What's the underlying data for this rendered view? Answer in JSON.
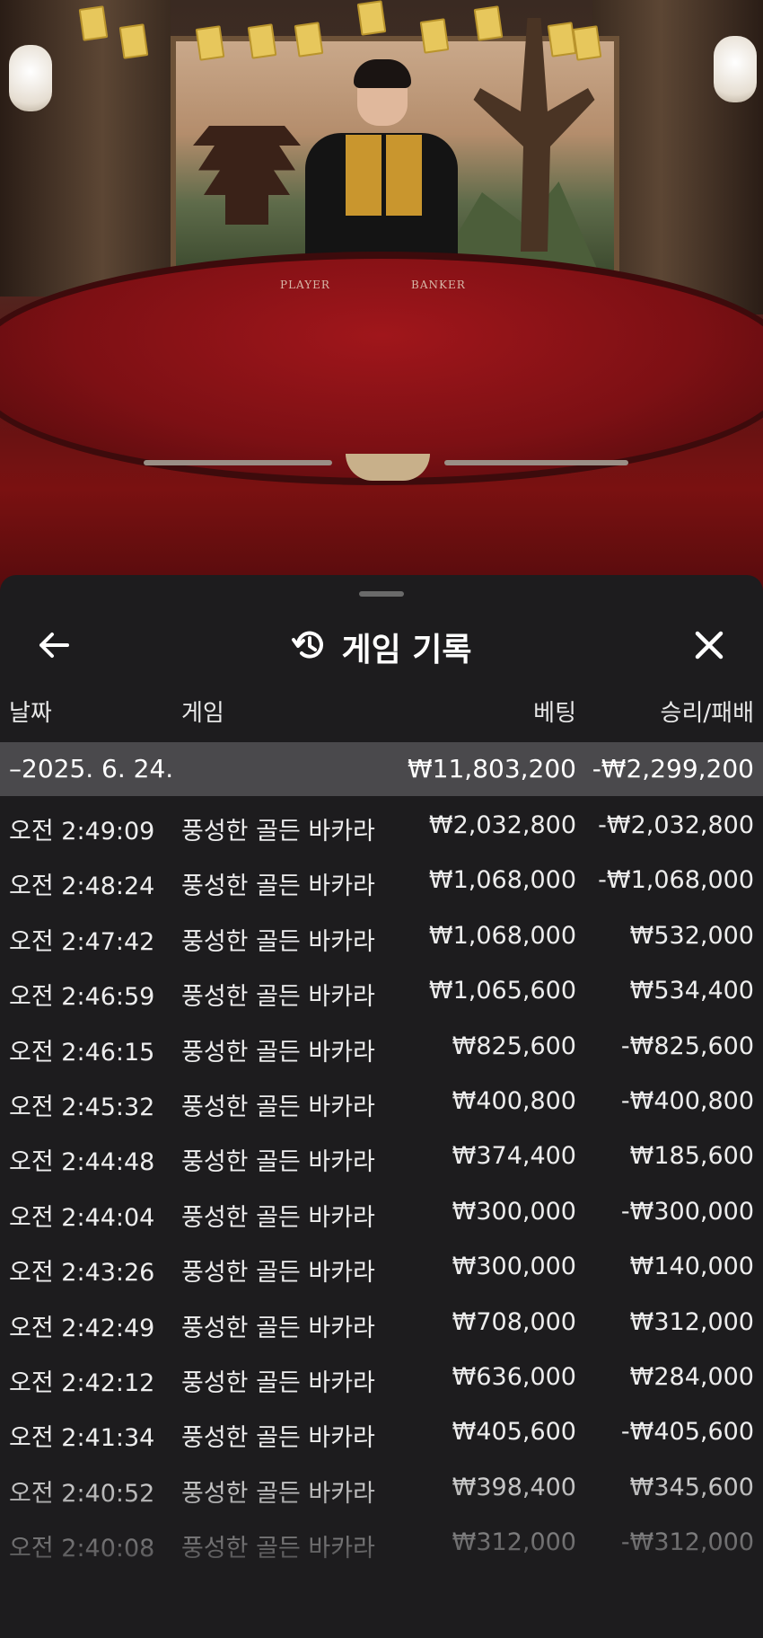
{
  "sheet": {
    "title": "게임 기록",
    "icons": {
      "back": "arrow-left-icon",
      "history": "history-icon",
      "close": "close-icon"
    },
    "columns": {
      "date": "날짜",
      "game": "게임",
      "bet": "베팅",
      "result": "승리/패배"
    },
    "summary": {
      "date": "–2025. 6. 24.",
      "bet": "₩11,803,200",
      "result": "-₩2,299,200"
    },
    "rows": [
      {
        "time": "오전 2:49:09",
        "game": "풍성한 골든 바카라",
        "bet": "₩2,032,800",
        "result": "-₩2,032,800"
      },
      {
        "time": "오전 2:48:24",
        "game": "풍성한 골든 바카라",
        "bet": "₩1,068,000",
        "result": "-₩1,068,000"
      },
      {
        "time": "오전 2:47:42",
        "game": "풍성한 골든 바카라",
        "bet": "₩1,068,000",
        "result": "₩532,000"
      },
      {
        "time": "오전 2:46:59",
        "game": "풍성한 골든 바카라",
        "bet": "₩1,065,600",
        "result": "₩534,400"
      },
      {
        "time": "오전 2:46:15",
        "game": "풍성한 골든 바카라",
        "bet": "₩825,600",
        "result": "-₩825,600"
      },
      {
        "time": "오전 2:45:32",
        "game": "풍성한 골든 바카라",
        "bet": "₩400,800",
        "result": "-₩400,800"
      },
      {
        "time": "오전 2:44:48",
        "game": "풍성한 골든 바카라",
        "bet": "₩374,400",
        "result": "₩185,600"
      },
      {
        "time": "오전 2:44:04",
        "game": "풍성한 골든 바카라",
        "bet": "₩300,000",
        "result": "-₩300,000"
      },
      {
        "time": "오전 2:43:26",
        "game": "풍성한 골든 바카라",
        "bet": "₩300,000",
        "result": "₩140,000"
      },
      {
        "time": "오전 2:42:49",
        "game": "풍성한 골든 바카라",
        "bet": "₩708,000",
        "result": "₩312,000"
      },
      {
        "time": "오전 2:42:12",
        "game": "풍성한 골든 바카라",
        "bet": "₩636,000",
        "result": "₩284,000"
      },
      {
        "time": "오전 2:41:34",
        "game": "풍성한 골든 바카라",
        "bet": "₩405,600",
        "result": "-₩405,600"
      },
      {
        "time": "오전 2:40:52",
        "game": "풍성한 골든 바카라",
        "bet": "₩398,400",
        "result": "₩345,600"
      },
      {
        "time": "오전 2:40:08",
        "game": "풍성한 골든 바카라",
        "bet": "₩312,000",
        "result": "-₩312,000"
      }
    ]
  },
  "table": {
    "player_label": "PLAYER",
    "banker_label": "BANKER"
  },
  "colors": {
    "sheet_bg": "#1d1c1e",
    "summary_bg": "#4a494c",
    "text": "#ededed",
    "table_felt": "#7d1014"
  }
}
